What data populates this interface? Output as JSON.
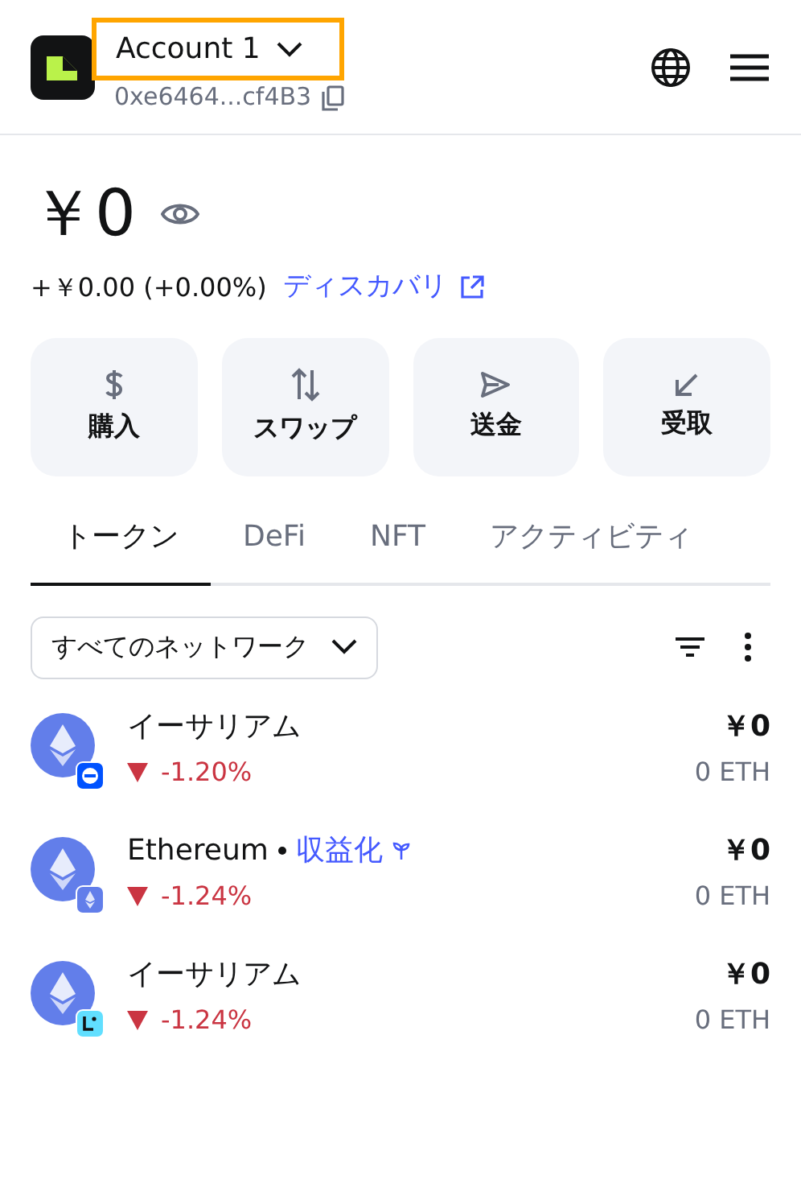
{
  "header": {
    "account": {
      "label": "Account 1",
      "highlighted": true
    },
    "address": "0xe6464...cf4B3"
  },
  "balance": {
    "amount": "￥0",
    "change": "+￥0.00 (+0.00%)",
    "discover_link": "ディスカバリ"
  },
  "actions": [
    {
      "kind": "buy",
      "label": "購入"
    },
    {
      "kind": "swap",
      "label": "スワップ"
    },
    {
      "kind": "send",
      "label": "送金"
    },
    {
      "kind": "receive",
      "label": "受取"
    }
  ],
  "tabs": [
    {
      "label": "トークン",
      "selected": true
    },
    {
      "label": "DeFi",
      "selected": false
    },
    {
      "label": "NFT",
      "selected": false
    },
    {
      "label": "アクティビティ",
      "selected": false
    }
  ],
  "network_filter": {
    "label": "すべてのネットワーク"
  },
  "tokens": [
    {
      "name": "イーサリアム",
      "change": {
        "kind": "down",
        "text": "-1.20%"
      },
      "fiat": "￥0",
      "amount": "0 ETH",
      "network": {
        "kind": "circle",
        "color": "#0052ff"
      }
    },
    {
      "name": "Ethereum",
      "earn_link": "収益化",
      "change": {
        "kind": "down",
        "text": "-1.24%"
      },
      "fiat": "￥0",
      "amount": "0 ETH",
      "network": {
        "kind": "eth",
        "color": "#627eea"
      }
    },
    {
      "name": "イーサリアム",
      "change": {
        "kind": "down",
        "text": "-1.24%"
      },
      "fiat": "￥0",
      "amount": "0 ETH",
      "network": {
        "kind": "corner",
        "color": "#61dfff"
      }
    }
  ]
}
